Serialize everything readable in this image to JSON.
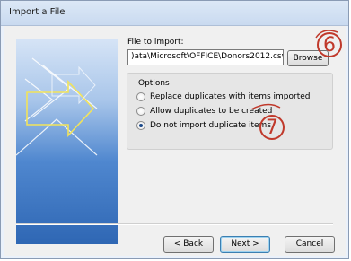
{
  "window": {
    "title": "Import a File"
  },
  "file_import": {
    "label": "File to import:",
    "value": ")ata\\Microsoft\\OFFICE\\Donors2012.csv",
    "browse_label": "Browse"
  },
  "options": {
    "title": "Options",
    "choices": [
      {
        "label": "Replace duplicates with items imported",
        "selected": false
      },
      {
        "label": "Allow duplicates to be created",
        "selected": false
      },
      {
        "label": "Do not import duplicate items",
        "selected": true
      }
    ]
  },
  "buttons": {
    "back": "< Back",
    "next": "Next >",
    "cancel": "Cancel"
  },
  "callouts": {
    "first": "6",
    "second": "7"
  },
  "colors": {
    "callout": "#c0392b",
    "accent": "#3c7fb1"
  },
  "icons": {
    "art": "wizard-arrows-art"
  }
}
